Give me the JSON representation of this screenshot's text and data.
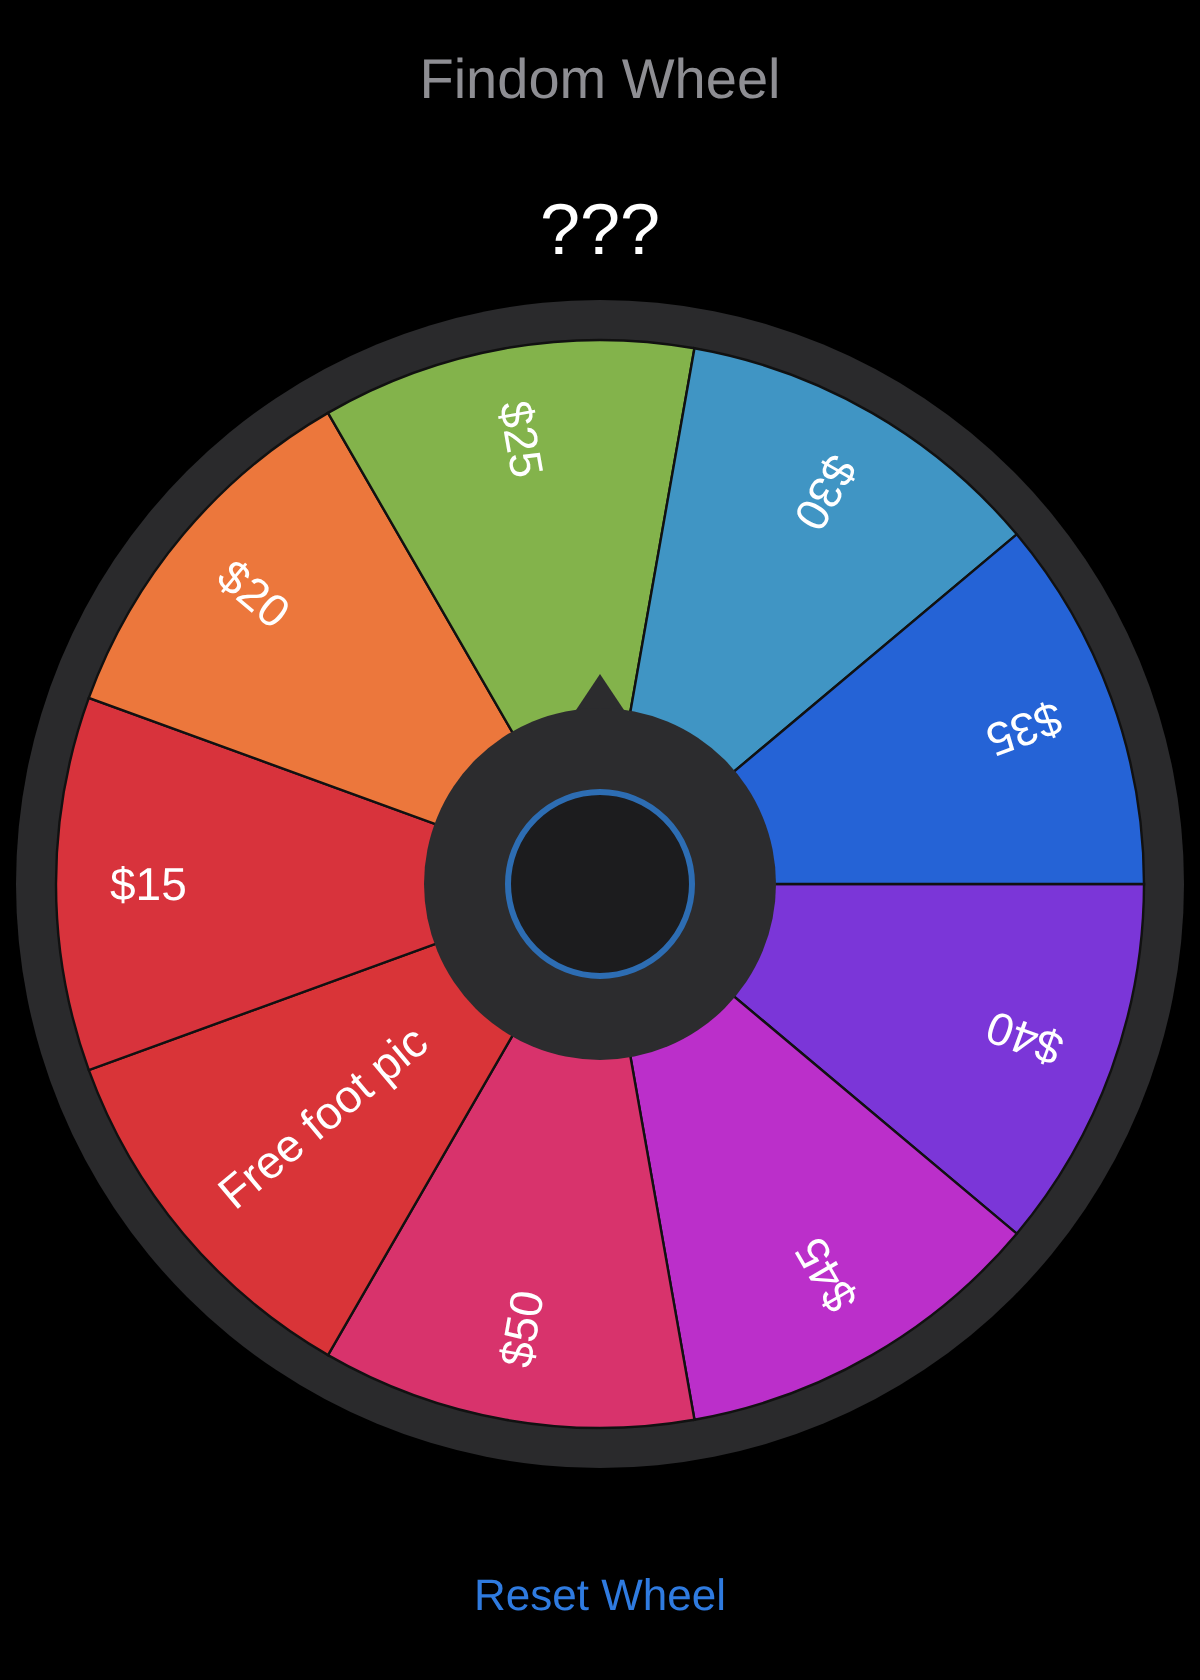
{
  "title": "Findom Wheel",
  "result": "???",
  "wheel": {
    "segments": [
      {
        "label": "$40",
        "color": "#7b36d8"
      },
      {
        "label": "$45",
        "color": "#bb2fca"
      },
      {
        "label": "$50",
        "color": "#d8336c"
      },
      {
        "label": "Free foot pic",
        "color": "#d93438"
      },
      {
        "label": "$15",
        "color": "#d8333c"
      },
      {
        "label": "$20",
        "color": "#ec773c"
      },
      {
        "label": "$25",
        "color": "#83b34b"
      },
      {
        "label": "$30",
        "color": "#4095c4"
      },
      {
        "label": "$35",
        "color": "#2563d6"
      }
    ]
  },
  "reset_button": "Reset Wheel"
}
